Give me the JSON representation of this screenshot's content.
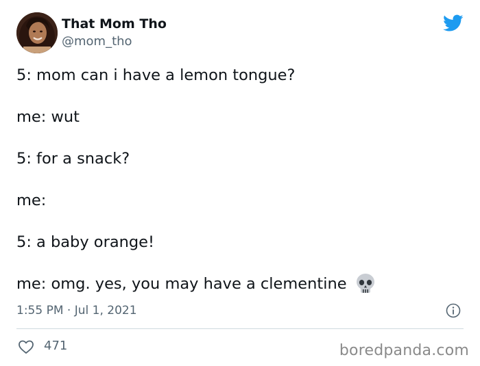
{
  "author": {
    "display_name": "That Mom Tho",
    "handle": "@mom_tho",
    "avatar_icon": "profile-photo"
  },
  "platform_icon": "twitter-bird-icon",
  "tweet": {
    "lines": [
      "5: mom can i have a lemon tongue?",
      "me: wut",
      "5: for a snack?",
      "me:",
      "5: a baby orange!",
      "me: omg. yes, you may have a clementine"
    ],
    "trailing_emoji": "skull-emoji"
  },
  "meta": {
    "timestamp": "1:55 PM · Jul 1, 2021"
  },
  "engagement": {
    "likes": "471"
  },
  "watermark": "boredpanda.com",
  "colors": {
    "brand_blue": "#1d9bf0",
    "secondary_text": "#536471",
    "divider": "#cfd9de"
  }
}
